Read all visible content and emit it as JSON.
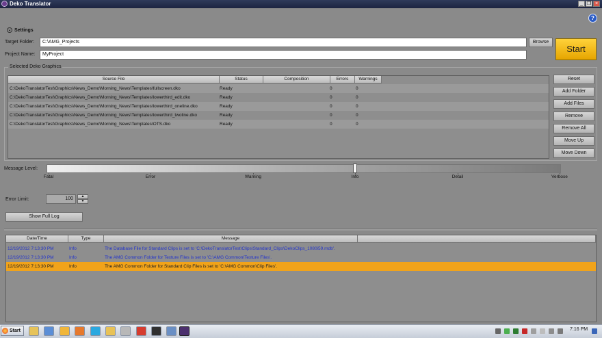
{
  "window": {
    "title": "Deko Translator",
    "minimize": "_",
    "restore": "❐",
    "close": "×"
  },
  "help": {
    "label": "?"
  },
  "settings": {
    "label": "Settings",
    "chevron": "⌄"
  },
  "target_folder": {
    "label": "Target Folder:",
    "value": "C:\\AMG_Projects",
    "browse": "Browse"
  },
  "project_name": {
    "label": "Project Name:",
    "value": "MyProject"
  },
  "start_label": "Start",
  "selected": {
    "title": "Selected Deko Graphics",
    "columns": [
      "Source File",
      "Status",
      "Composition",
      "Errors",
      "Warnings"
    ],
    "rows": [
      {
        "file": "C:\\DekoTranslatorTest\\Graphics\\News_Demo\\Morning_News\\Templates\\fullscreen.dko",
        "status": "Ready",
        "errors": "0",
        "warnings": "0"
      },
      {
        "file": "C:\\DekoTranslatorTest\\Graphics\\News_Demo\\Morning_News\\Templates\\lowerthird_edit.dko",
        "status": "Ready",
        "errors": "0",
        "warnings": "0"
      },
      {
        "file": "C:\\DekoTranslatorTest\\Graphics\\News_Demo\\Morning_News\\Templates\\lowerthird_oneline.dko",
        "status": "Ready",
        "errors": "0",
        "warnings": "0"
      },
      {
        "file": "C:\\DekoTranslatorTest\\Graphics\\News_Demo\\Morning_News\\Templates\\lowerthird_twoline.dko",
        "status": "Ready",
        "errors": "0",
        "warnings": "0"
      },
      {
        "file": "C:\\DekoTranslatorTest\\Graphics\\News_Demo\\Morning_News\\Templates\\OTS.dko",
        "status": "Ready",
        "errors": "0",
        "warnings": "0"
      }
    ],
    "buttons": [
      "Reset",
      "Add Folder",
      "Add Files",
      "Remove",
      "Remove All",
      "Move Up",
      "Move Down"
    ]
  },
  "message_level": {
    "label": "Message Level:",
    "levels": [
      "Fatal",
      "Error",
      "Warning",
      "Info",
      "Detail",
      "Verbose"
    ],
    "selected": "Info"
  },
  "error_limit": {
    "label": "Error Limit:",
    "value": "100",
    "up": "▲",
    "down": "▼"
  },
  "show_log": "Show Full Log",
  "log": {
    "columns": [
      "Date/Time",
      "Type",
      "Message"
    ],
    "rows": [
      {
        "time": "12/19/2012 7:13:30 PM",
        "type": "Info",
        "message": "The Database File for Standard Clips is set to 'C:\\DekoTranslatorTest\\Clips\\Standard_Clips\\DekoClips_1080i59.mdb'.",
        "selected": false
      },
      {
        "time": "12/19/2012 7:13:30 PM",
        "type": "Info",
        "message": "The AMG Common Folder for Texture Files is set to 'C:\\AMG Common\\Texture Files'.",
        "selected": false
      },
      {
        "time": "12/19/2012 7:13:30 PM",
        "type": "Info",
        "message": "The AMG Common Folder for Standard Clip Files is set to 'C:\\AMG Common\\Clip Files'.",
        "selected": true
      }
    ]
  },
  "taskbar": {
    "start": "Start",
    "clock": "7:16 PM",
    "apps": [
      "explorer-icon",
      "word-icon",
      "chrome-icon",
      "firefox-icon",
      "skype-icon",
      "folder-icon",
      "ftp-icon",
      "acrobat-icon",
      "terminal-icon",
      "remote-icon",
      "deko-icon"
    ]
  }
}
